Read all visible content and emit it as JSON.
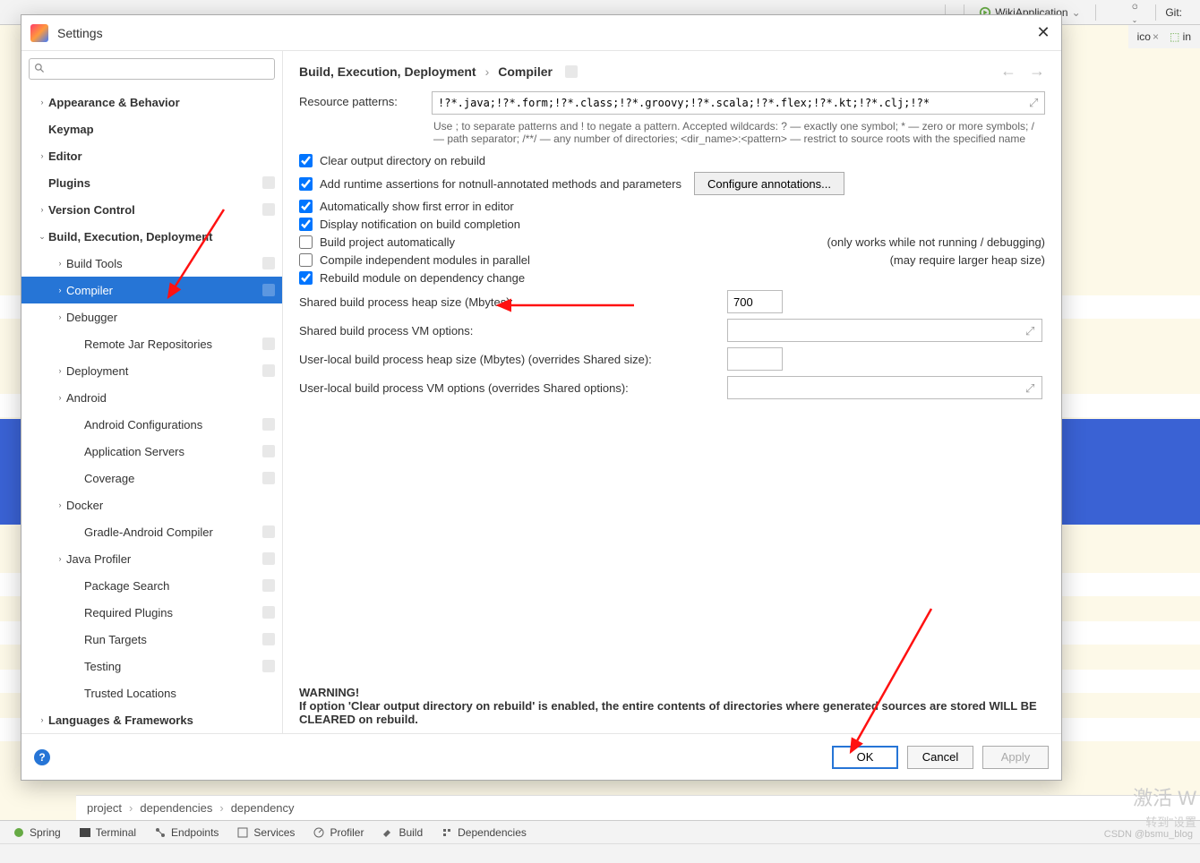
{
  "toolbar": {
    "run_config": "WikiApplication",
    "git_label": "Git:"
  },
  "tabs": {
    "t1": "ico",
    "t2": "in"
  },
  "dialog": {
    "title": "Settings"
  },
  "search": {
    "placeholder": ""
  },
  "tree": [
    {
      "label": "Appearance & Behavior",
      "bold": true,
      "indent": 0,
      "arrow": "›"
    },
    {
      "label": "Keymap",
      "bold": true,
      "indent": 0,
      "arrow": ""
    },
    {
      "label": "Editor",
      "bold": true,
      "indent": 0,
      "arrow": "›"
    },
    {
      "label": "Plugins",
      "bold": true,
      "indent": 0,
      "arrow": "",
      "badge": true
    },
    {
      "label": "Version Control",
      "bold": true,
      "indent": 0,
      "arrow": "›",
      "badge": true
    },
    {
      "label": "Build, Execution, Deployment",
      "bold": true,
      "indent": 0,
      "arrow": "⌄"
    },
    {
      "label": "Build Tools",
      "indent": 1,
      "arrow": "›",
      "badge": true
    },
    {
      "label": "Compiler",
      "indent": 1,
      "arrow": "›",
      "badge": true,
      "selected": true
    },
    {
      "label": "Debugger",
      "indent": 1,
      "arrow": "›"
    },
    {
      "label": "Remote Jar Repositories",
      "indent": 2,
      "arrow": "",
      "badge": true
    },
    {
      "label": "Deployment",
      "indent": 1,
      "arrow": "›",
      "badge": true
    },
    {
      "label": "Android",
      "indent": 1,
      "arrow": "›"
    },
    {
      "label": "Android Configurations",
      "indent": 2,
      "arrow": "",
      "badge": true
    },
    {
      "label": "Application Servers",
      "indent": 2,
      "arrow": "",
      "badge": true
    },
    {
      "label": "Coverage",
      "indent": 2,
      "arrow": "",
      "badge": true
    },
    {
      "label": "Docker",
      "indent": 1,
      "arrow": "›"
    },
    {
      "label": "Gradle-Android Compiler",
      "indent": 2,
      "arrow": "",
      "badge": true
    },
    {
      "label": "Java Profiler",
      "indent": 1,
      "arrow": "›",
      "badge": true
    },
    {
      "label": "Package Search",
      "indent": 2,
      "arrow": "",
      "badge": true
    },
    {
      "label": "Required Plugins",
      "indent": 2,
      "arrow": "",
      "badge": true
    },
    {
      "label": "Run Targets",
      "indent": 2,
      "arrow": "",
      "badge": true
    },
    {
      "label": "Testing",
      "indent": 2,
      "arrow": "",
      "badge": true
    },
    {
      "label": "Trusted Locations",
      "indent": 2,
      "arrow": ""
    },
    {
      "label": "Languages & Frameworks",
      "bold": true,
      "indent": 0,
      "arrow": "›"
    }
  ],
  "crumbs": {
    "a": "Build, Execution, Deployment",
    "b": "Compiler"
  },
  "form": {
    "resource_patterns_label": "Resource patterns:",
    "resource_patterns_value": "!?*.java;!?*.form;!?*.class;!?*.groovy;!?*.scala;!?*.flex;!?*.kt;!?*.clj;!?*",
    "help_text": "Use ; to separate patterns and ! to negate a pattern. Accepted wildcards: ? — exactly one symbol; * — zero or more symbols; / — path separator; /**/ — any number of directories; <dir_name>:<pattern> — restrict to source roots with the specified name",
    "chk_clear": "Clear output directory on rebuild",
    "chk_assert": "Add runtime assertions for notnull-annotated methods and parameters",
    "btn_configure": "Configure annotations...",
    "chk_auto_error": "Automatically show first error in editor",
    "chk_notify": "Display notification on build completion",
    "chk_build_auto": "Build project automatically",
    "chk_build_auto_note": "(only works while not running / debugging)",
    "chk_parallel": "Compile independent modules in parallel",
    "chk_parallel_note": "(may require larger heap size)",
    "chk_rebuild_dep": "Rebuild module on dependency change",
    "heap_label": "Shared build process heap size (Mbytes):",
    "heap_value": "700",
    "vm_label": "Shared build process VM options:",
    "user_heap_label": "User-local build process heap size (Mbytes) (overrides Shared size):",
    "user_vm_label": "User-local build process VM options (overrides Shared options):"
  },
  "warning": {
    "title": "WARNING!",
    "body": "If option 'Clear output directory on rebuild' is enabled, the entire contents of directories where generated sources are stored WILL BE CLEARED on rebuild."
  },
  "footer": {
    "ok": "OK",
    "cancel": "Cancel",
    "apply": "Apply"
  },
  "breadcrumb": {
    "a": "project",
    "b": "dependencies",
    "c": "dependency"
  },
  "toolwindows": [
    "Spring",
    "Terminal",
    "Endpoints",
    "Services",
    "Profiler",
    "Build",
    "Dependencies"
  ],
  "watermark": {
    "line1": "激活 W",
    "line2": "转到\"设置"
  },
  "csdn": "CSDN @bsmu_blog"
}
